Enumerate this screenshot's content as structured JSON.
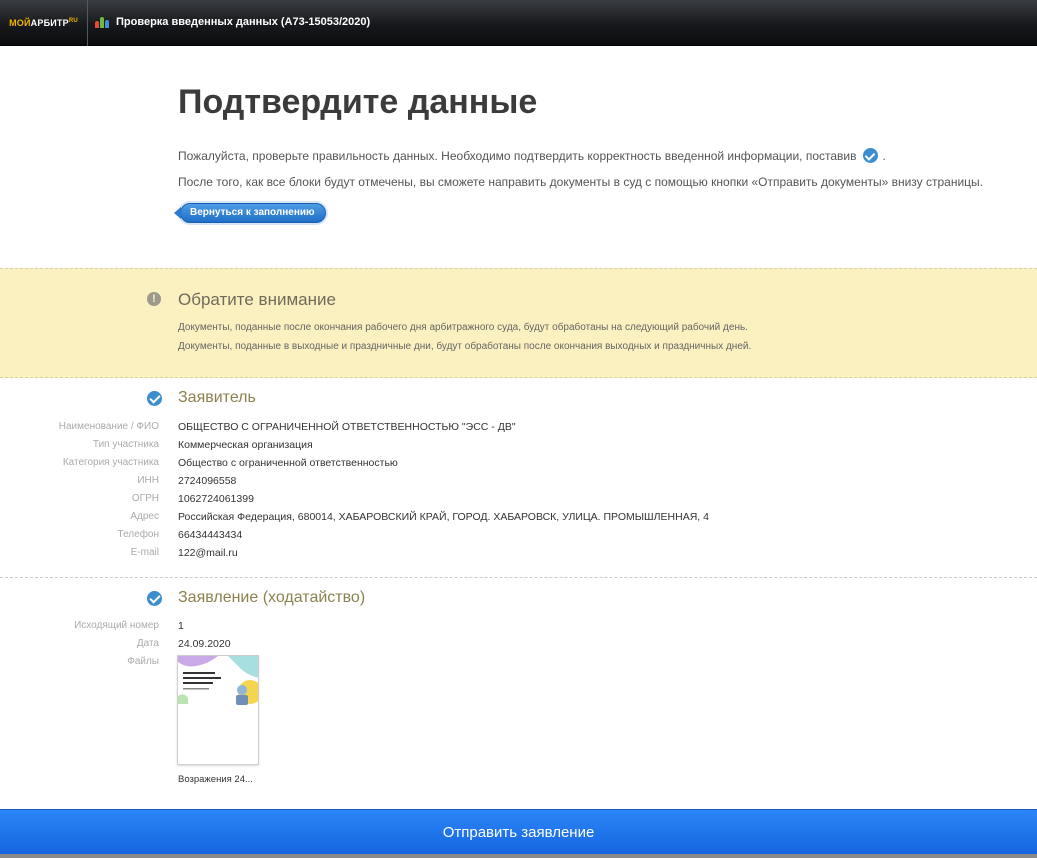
{
  "topbar": {
    "logo_moi": "МОЙ",
    "logo_arbitr": "АРБИТР",
    "logo_ru": "RU",
    "title": "Проверка введенных данных  (А73-15053/2020)"
  },
  "header": {
    "title": "Подтвердите данные",
    "intro_line1": "Пожалуйста, проверьте правильность данных. Необходимо подтвердить корректность введенной информации, поставив",
    "intro_line1_end": ".",
    "intro_line2": "После того, как все блоки будут отмечены, вы сможете направить документы в суд с помощью кнопки «Отправить документы» внизу страницы.",
    "back_button": "Вернуться к заполнению"
  },
  "notice": {
    "title": "Обратите внимание",
    "line1": "Документы, поданные после окончания рабочего дня арбитражного суда, будут обработаны на следующий рабочий день.",
    "line2": "Документы, поданные в выходные и праздничные дни, будут обработаны после окончания выходных и праздничных дней."
  },
  "applicant": {
    "title": "Заявитель",
    "rows": [
      {
        "label": "Наименование / ФИО",
        "value": "ОБЩЕСТВО С ОГРАНИЧЕННОЙ ОТВЕТСТВЕННОСТЬЮ \"ЭСС - ДВ\""
      },
      {
        "label": "Тип участника",
        "value": "Коммерческая организация"
      },
      {
        "label": "Категория участника",
        "value": "Общество с ограниченной ответственностью"
      },
      {
        "label": "ИНН",
        "value": "2724096558"
      },
      {
        "label": "ОГРН",
        "value": "1062724061399"
      },
      {
        "label": "Адрес",
        "value": "Российская Федерация, 680014, ХАБАРОВСКИЙ КРАЙ, ГОРОД. ХАБАРОВСК, УЛИЦА. ПРОМЫШЛЕННАЯ, 4"
      },
      {
        "label": "Телефон",
        "value": "66434443434"
      },
      {
        "label": "E-mail",
        "value": "122@mail.ru"
      }
    ]
  },
  "statement": {
    "title": "Заявление (ходатайство)",
    "rows": [
      {
        "label": "Исходящий номер",
        "value": "1"
      },
      {
        "label": "Дата",
        "value": "24.09.2020"
      },
      {
        "label": "Файлы",
        "value": ""
      }
    ],
    "file_name": "Возражения 24..."
  },
  "footer": {
    "submit_button": "Отправить заявление"
  },
  "colors": {
    "accent": "#3b8fcf",
    "notice_bg": "#fbf0c0",
    "submit": "#1f74ec"
  }
}
